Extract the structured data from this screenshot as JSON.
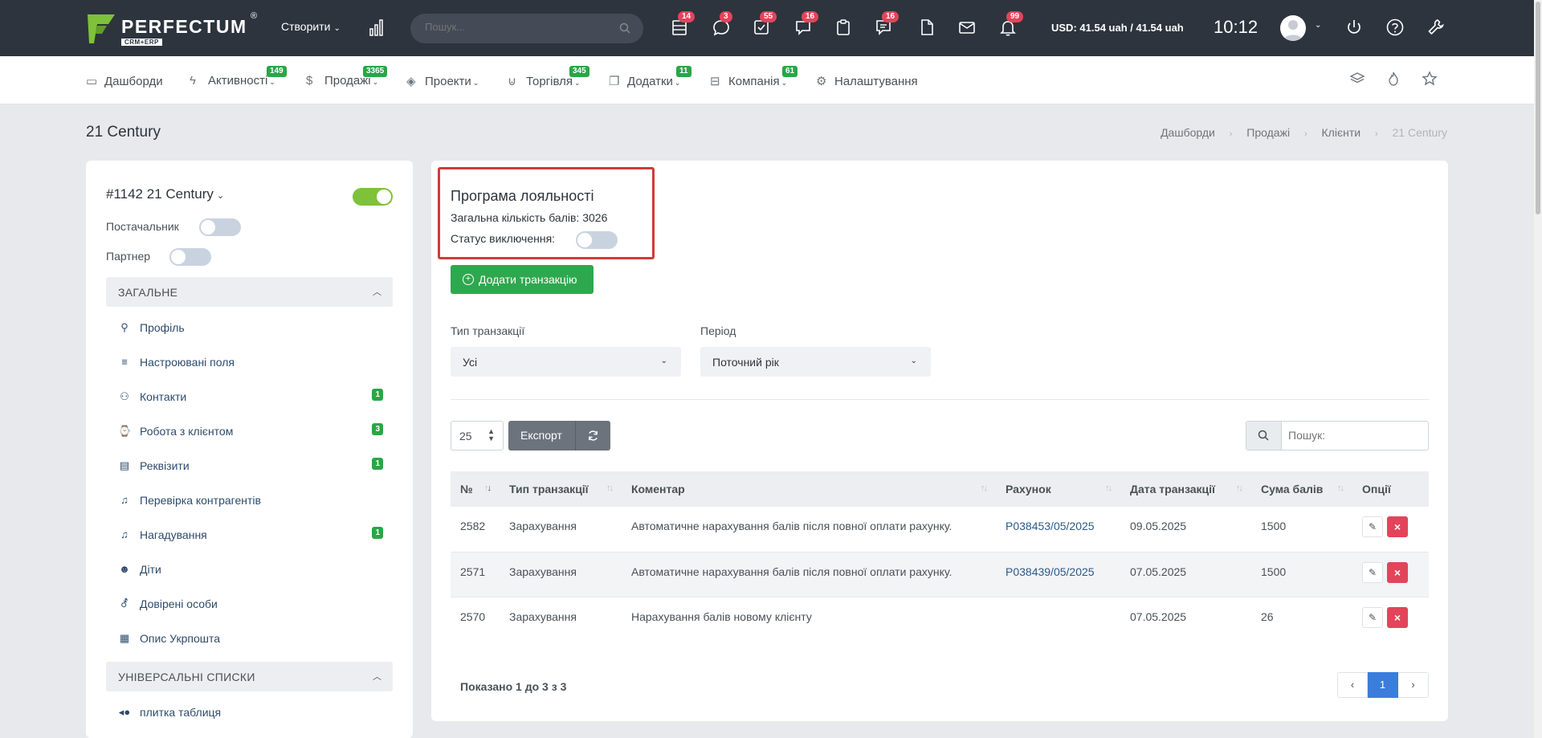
{
  "topbar": {
    "logo_name": "PERFECTUM",
    "logo_reg": "®",
    "logo_sub": "CRM+ERP",
    "create_label": "Створити",
    "search_placeholder": "Пошук...",
    "icons": [
      {
        "name": "tasks-list-icon",
        "badge": "14"
      },
      {
        "name": "chat-bubble-icon",
        "badge": "3"
      },
      {
        "name": "checkbox-icon",
        "badge": "55"
      },
      {
        "name": "comments-icon",
        "badge": "16"
      },
      {
        "name": "clipboard-icon",
        "badge": ""
      },
      {
        "name": "messages-icon",
        "badge": "16"
      },
      {
        "name": "document-icon",
        "badge": ""
      },
      {
        "name": "mail-icon",
        "badge": ""
      },
      {
        "name": "bell-icon",
        "badge": "99"
      }
    ],
    "currency": "USD: 41.54 uah / 41.54 uah",
    "time": "10:12"
  },
  "nav": {
    "items": [
      {
        "label": "Дашборди",
        "icon": "monitor-icon",
        "badge": ""
      },
      {
        "label": "Активності",
        "icon": "lightning-icon",
        "badge": "149"
      },
      {
        "label": "Продажі",
        "icon": "dollar-icon",
        "badge": "3365"
      },
      {
        "label": "Проекти",
        "icon": "layers-icon",
        "badge": ""
      },
      {
        "label": "Торгівля",
        "icon": "cart-icon",
        "badge": "345"
      },
      {
        "label": "Додатки",
        "icon": "copy-icon",
        "badge": "11"
      },
      {
        "label": "Компанія",
        "icon": "briefcase-icon",
        "badge": "61"
      },
      {
        "label": "Налаштування",
        "icon": "gear-icon",
        "badge": ""
      }
    ]
  },
  "page": {
    "title": "21 Century",
    "breadcrumb": [
      "Дашборди",
      "Продажі",
      "Клієнти",
      "21 Century"
    ]
  },
  "client": {
    "title": "#1142 21 Century",
    "active": true,
    "supplier_label": "Постачальник",
    "partner_label": "Партнер",
    "section_general": "ЗАГАЛЬНЕ",
    "menu": [
      {
        "label": "Профіль",
        "icon": "user-icon",
        "badge": ""
      },
      {
        "label": "Настроювані поля",
        "icon": "lines-icon",
        "badge": ""
      },
      {
        "label": "Контакти",
        "icon": "users-icon",
        "badge": "1"
      },
      {
        "label": "Робота з клієнтом",
        "icon": "watch-icon",
        "badge": "3"
      },
      {
        "label": "Реквізити",
        "icon": "id-card-icon",
        "badge": "1"
      },
      {
        "label": "Перевірка контрагентів",
        "icon": "bell-outline-icon",
        "badge": ""
      },
      {
        "label": "Нагадування",
        "icon": "bell-outline-icon",
        "badge": "1"
      },
      {
        "label": "Діти",
        "icon": "baby-icon",
        "badge": ""
      },
      {
        "label": "Довірені особи",
        "icon": "person-trust-icon",
        "badge": ""
      },
      {
        "label": "Опис Укрпошта",
        "icon": "boxes-icon",
        "badge": ""
      }
    ],
    "section_lists": "УНІВЕРСАЛЬНІ СПИСКИ",
    "lists": [
      {
        "label": "плитка таблиця",
        "icon": "fish-icon"
      }
    ]
  },
  "loyalty": {
    "title": "Програма лояльності",
    "total_label": "Загальна кількість балів: 3026",
    "status_label": "Статус виключення:",
    "add_button": "Додати транзакцію"
  },
  "filters": {
    "type_label": "Тип транзакції",
    "type_value": "Усі",
    "period_label": "Період",
    "period_value": "Поточний рік"
  },
  "table_controls": {
    "per_page": "25",
    "export_label": "Експорт",
    "search_placeholder": "Пошук:"
  },
  "table": {
    "headers": [
      "№",
      "Тип транзакції",
      "Коментар",
      "Рахунок",
      "Дата транзакції",
      "Сума балів",
      "Опції"
    ],
    "rows": [
      {
        "id": "2582",
        "type": "Зарахування",
        "comment": "Автоматичне нарахування балів після повної оплати рахунку.",
        "invoice": "P038453/05/2025",
        "date": "09.05.2025",
        "points": "1500"
      },
      {
        "id": "2571",
        "type": "Зарахування",
        "comment": "Автоматичне нарахування балів після повної оплати рахунку.",
        "invoice": "P038439/05/2025",
        "date": "07.05.2025",
        "points": "1500"
      },
      {
        "id": "2570",
        "type": "Зарахування",
        "comment": "Нарахування балів новому клієнту",
        "invoice": "",
        "date": "07.05.2025",
        "points": "26"
      }
    ],
    "shown_text": "Показано 1 до 3 з 3",
    "pagination": {
      "prev": "‹",
      "current": "1",
      "next": "›"
    }
  },
  "colors": {
    "topbar": "#2d343e",
    "accent_green": "#2ea84f",
    "badge_red": "#e3445a",
    "highlight_border": "#d23a3a",
    "link": "#2b5a8a"
  }
}
